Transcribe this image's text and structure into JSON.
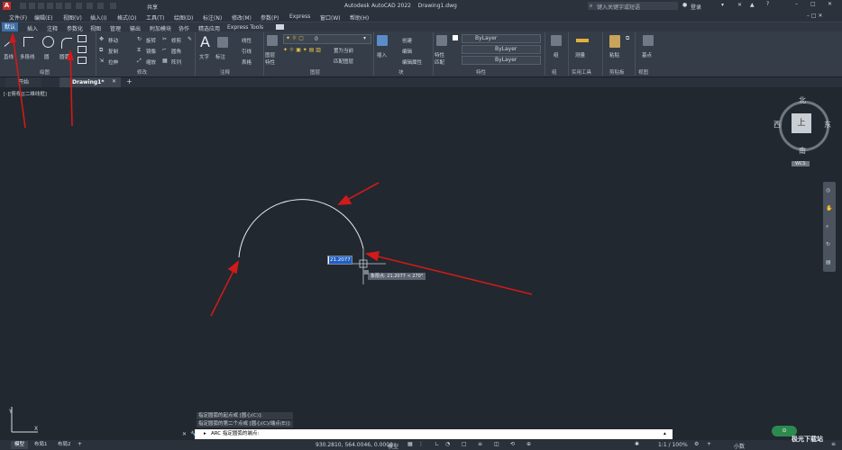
{
  "app": {
    "title": "Autodesk AutoCAD 2022    Drawing1.dwg",
    "search_placeholder": "键入关键字或短语",
    "login": "登录",
    "share_label": "共享"
  },
  "menu": [
    "文件(F)",
    "编辑(E)",
    "视图(V)",
    "插入(I)",
    "格式(O)",
    "工具(T)",
    "绘图(D)",
    "标注(N)",
    "修改(M)",
    "参数(P)",
    "Express",
    "窗口(W)",
    "帮助(H)"
  ],
  "ribbon_tabs": [
    "默认",
    "插入",
    "注释",
    "参数化",
    "视图",
    "管理",
    "输出",
    "附加模块",
    "协作",
    "精选应用",
    "Express Tools"
  ],
  "ribbon": {
    "draw": {
      "title": "绘图",
      "line": "直线",
      "polyline": "多段线",
      "circle": "圆",
      "arc": "圆弧"
    },
    "modify": {
      "title": "修改",
      "move": "移动",
      "rotate": "旋转",
      "trim": "修剪",
      "copy": "复制",
      "mirror": "镜像",
      "fillet": "圆角",
      "stretch": "拉伸",
      "scale": "缩放",
      "array": "阵列"
    },
    "annotation": {
      "title": "注释",
      "text": "文字",
      "dimension": "标注",
      "linear": "线性",
      "leader": "引线",
      "table": "表格"
    },
    "layers": {
      "title": "图层",
      "layer_props": "图层特性",
      "current_layer": "0",
      "make_current": "置为当前",
      "match_layer": "匹配图层"
    },
    "block": {
      "title": "块",
      "insert": "插入",
      "create": "创建",
      "edit": "编辑",
      "edit_attr": "编辑属性"
    },
    "properties": {
      "title": "特性",
      "match": "特性匹配",
      "bylayer1": "ByLayer",
      "bylayer2": "ByLayer",
      "bylayer3": "ByLayer"
    },
    "groups": {
      "title": "组",
      "group": "组"
    },
    "utilities": {
      "title": "实用工具",
      "measure": "测量"
    },
    "clipboard": {
      "title": "剪贴板",
      "paste": "粘贴"
    },
    "view": {
      "title": "视图",
      "base": "基点"
    }
  },
  "file_tabs": [
    "开始",
    "Drawing1*"
  ],
  "viewport_label": "[-][俯视][二维线框]",
  "viewcube": {
    "north": "北",
    "south": "南",
    "east": "东",
    "west": "西",
    "top": "上",
    "wcs": "WCS"
  },
  "drawing": {
    "input_value": "21.2077",
    "tooltip": "象限点: 21.2077 < 270°"
  },
  "command": {
    "history": [
      "指定圆弧的起点或 [圆心(C)]:",
      "指定圆弧的第二个点或 [圆心(C)/端点(E)]:"
    ],
    "prompt": "ARC 指定圆弧的端点:"
  },
  "layouts": [
    "模型",
    "布局1",
    "布局2"
  ],
  "status": {
    "coords": "930.2810, 564.0046, 0.0000",
    "model": "模型",
    "scale": "1:1 / 100%",
    "small": "小数"
  },
  "watermark": "极光下载站",
  "colors": {
    "canvas": "#212830",
    "arrow": "#d11a1a",
    "selection": "#1e5fc8",
    "panel": "#353d48"
  }
}
